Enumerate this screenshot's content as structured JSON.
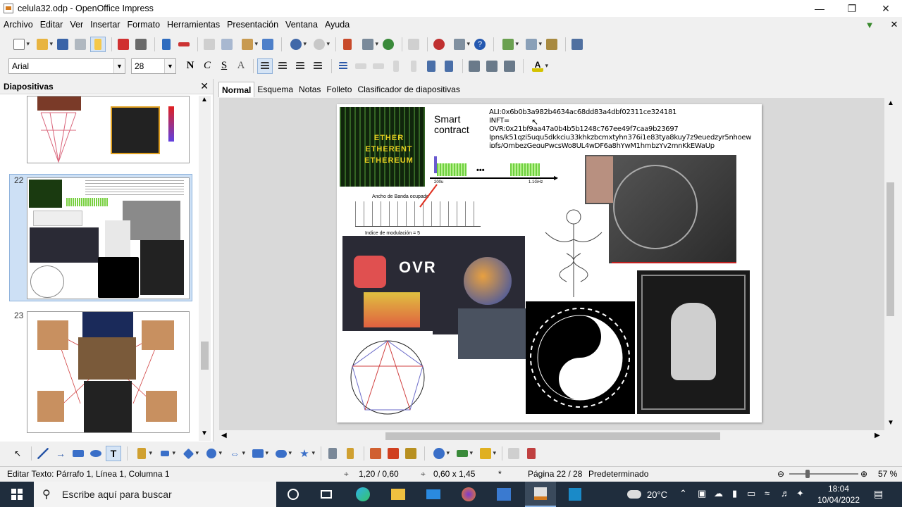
{
  "window": {
    "title": "celula32.odp - OpenOffice Impress"
  },
  "menus": [
    "Archivo",
    "Editar",
    "Ver",
    "Insertar",
    "Formato",
    "Herramientas",
    "Presentación",
    "Ventana",
    "Ayuda"
  ],
  "format_bar": {
    "font_name": "Arial",
    "font_size": "28"
  },
  "slides_panel": {
    "title": "Diapositivas",
    "slide_numbers": [
      "22",
      "23"
    ]
  },
  "view_tabs": [
    "Normal",
    "Esquema",
    "Notas",
    "Folleto",
    "Clasificador de diapositivas"
  ],
  "slide": {
    "smart_label": "Smart\ncontract",
    "hash_lines": [
      "ALI:0x6b0b3a982b4634ac68dd83a4dbf02311ce324181",
      "INFT=",
      "OVR:0x21bf9aa47a0b4b5b1248c767ee49f7caa9b23697",
      "Ipns/k51qzi5uqu5dkkciu33khkzbcmxtyhn376i1e83tya8kuy7z9euedzyr5nhoew",
      "ipfs/QmbezGequPwcsWo8UL4wDF6a8hYwM1hmbzYv2mnKkEWaUp"
    ],
    "ether_text": [
      "ETHER",
      "ETHERENT",
      "ETHEREUM"
    ],
    "spectrum_left": "200u",
    "spectrum_right": "1.1GHz",
    "dots": "•••",
    "band_title": "Ancho de Banda ocupado",
    "band_bottom": "Indice de modulación = 5",
    "ovr_text": "OVR"
  },
  "status": {
    "edit_text": "Editar Texto: Párrafo 1, Línea 1, Columna 1",
    "position": "1,20 / 0,60",
    "size": "0,60 x 1,45",
    "page": "Página 22 / 28",
    "layout": "Predeterminado",
    "zoom": "57 %"
  },
  "taskbar": {
    "search_placeholder": "Escribe aquí para buscar",
    "temperature": "20°C",
    "time": "18:04",
    "date": "10/04/2022"
  },
  "colors": {
    "accent": "#3f7fc6",
    "taskbar": "#1f2d3d",
    "selection": "#cde0f5"
  }
}
